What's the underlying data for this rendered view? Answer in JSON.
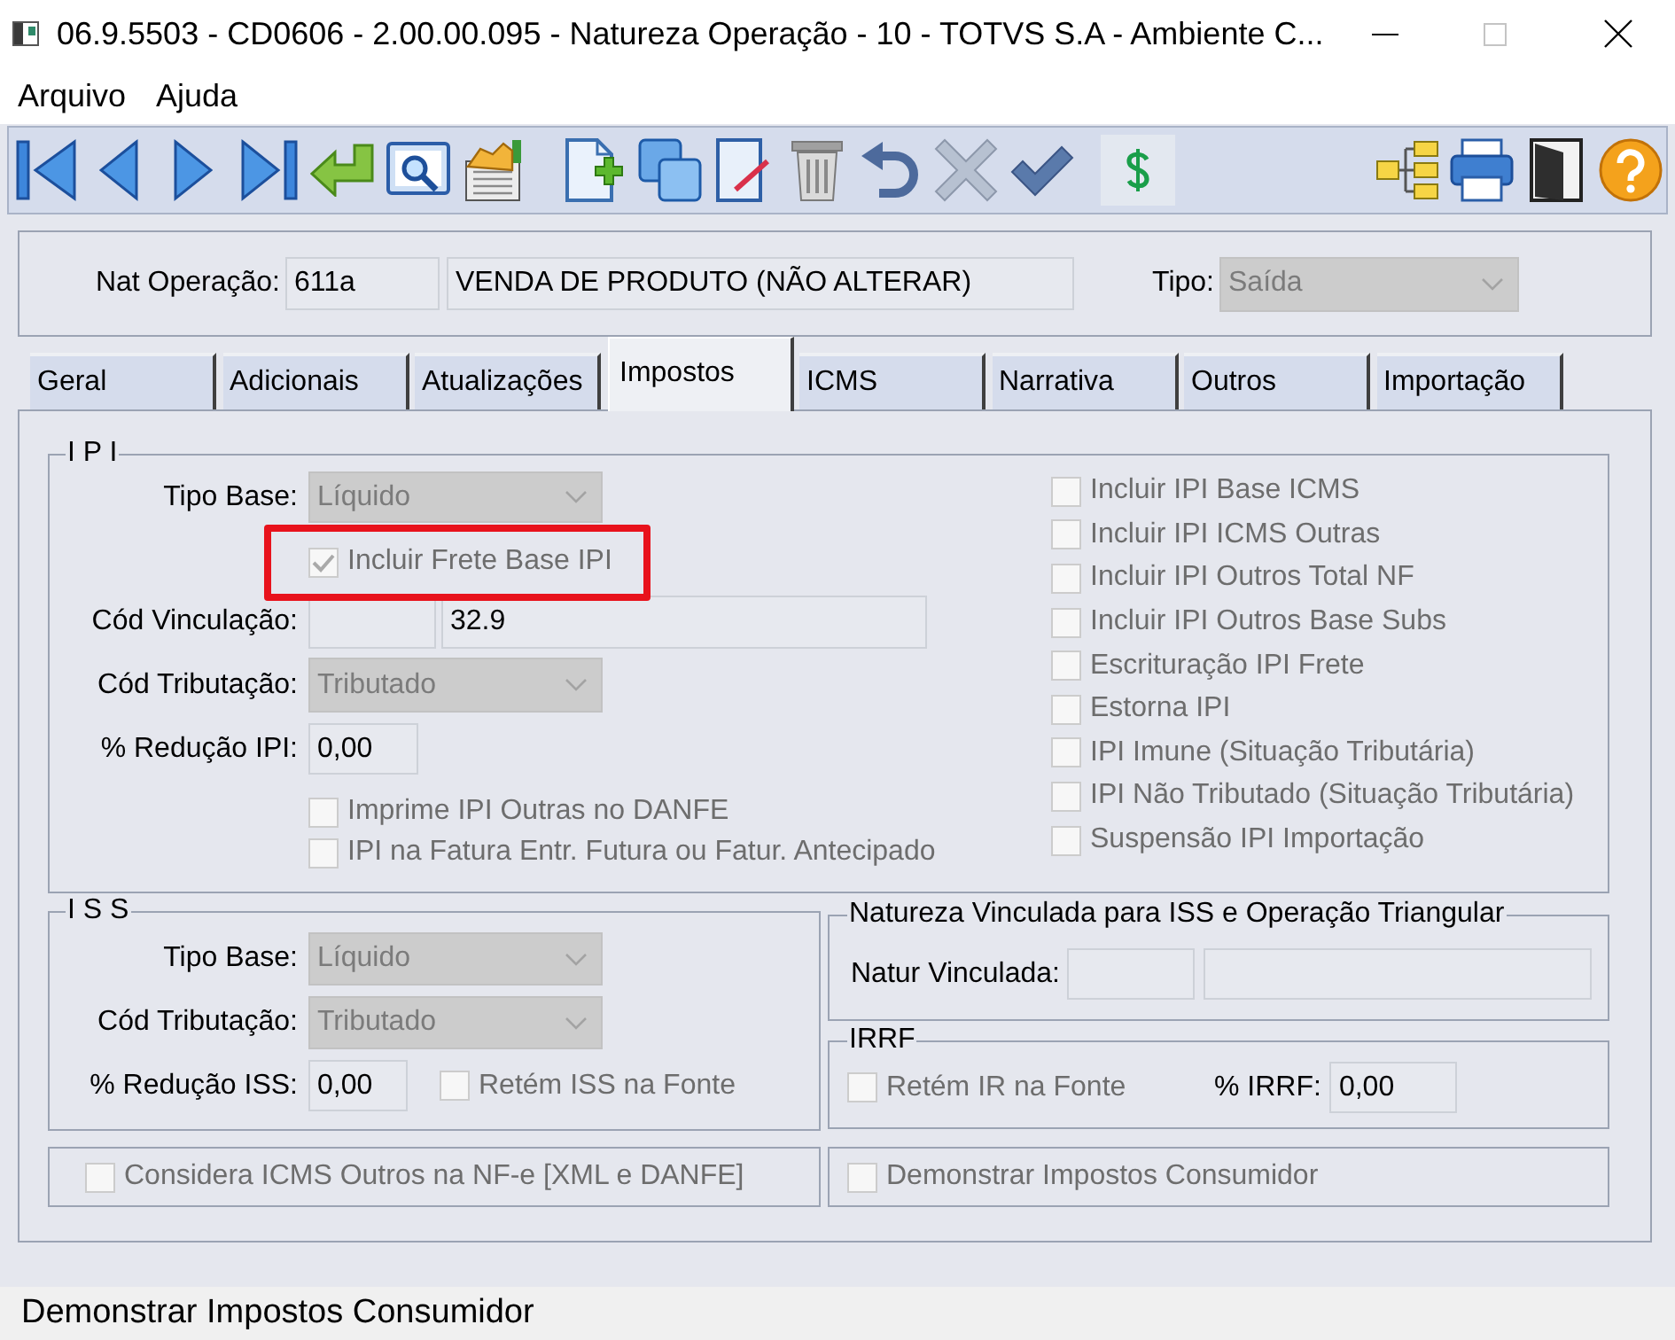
{
  "window": {
    "title": "06.9.5503 - CD0606 - 2.00.00.095 - Natureza Operação - 10 - TOTVS S.A - Ambiente C..."
  },
  "menu": [
    {
      "label": "Arquivo"
    },
    {
      "label": "Ajuda"
    }
  ],
  "header": {
    "nat_operacao": {
      "label": "Nat Operação:",
      "code": "611a",
      "description": "VENDA DE PRODUTO (NÃO ALTERAR)"
    },
    "tipo": {
      "label": "Tipo:",
      "value": "Saída",
      "disabled": true
    }
  },
  "tabs": [
    {
      "label": "Geral",
      "selected": false
    },
    {
      "label": "Adicionais",
      "selected": false
    },
    {
      "label": "Atualizações",
      "selected": false
    },
    {
      "label": "Impostos",
      "selected": true
    },
    {
      "label": "ICMS",
      "selected": false
    },
    {
      "label": "Narrativa",
      "selected": false
    },
    {
      "label": "Outros",
      "selected": false
    },
    {
      "label": "Importação",
      "selected": false
    }
  ],
  "ipi": {
    "legend": "I P I",
    "tipo_base": {
      "label": "Tipo Base:",
      "value": "Líquido",
      "disabled": true
    },
    "incluir_frete": {
      "label": "Incluir Frete Base IPI",
      "checked": true,
      "disabled": true,
      "highlighted": true
    },
    "cod_vinculacao": {
      "label": "Cód Vinculação:",
      "value": "32.9"
    },
    "cod_tributacao": {
      "label": "Cód Tributação:",
      "value": "Tributado",
      "disabled": true
    },
    "reducao": {
      "label": "% Redução IPI:",
      "value": "0,00"
    },
    "options_left": [
      {
        "label": "Imprime IPI Outras no DANFE",
        "checked": false,
        "disabled": true
      },
      {
        "label": "IPI na Fatura Entr. Futura ou Fatur. Antecipado",
        "checked": false,
        "disabled": true
      }
    ],
    "options_right": [
      {
        "label": "Incluir IPI Base ICMS",
        "checked": false,
        "disabled": true
      },
      {
        "label": "Incluir IPI ICMS Outras",
        "checked": false,
        "disabled": true
      },
      {
        "label": "Incluir IPI Outros Total NF",
        "checked": false,
        "disabled": true
      },
      {
        "label": "Incluir IPI Outros Base Subs",
        "checked": false,
        "disabled": true
      },
      {
        "label": "Escrituração IPI Frete",
        "checked": false,
        "disabled": true
      },
      {
        "label": "Estorna IPI",
        "checked": false,
        "disabled": true
      },
      {
        "label": "IPI Imune (Situação Tributária)",
        "checked": false,
        "disabled": true
      },
      {
        "label": "IPI Não Tributado (Situação Tributária)",
        "checked": false,
        "disabled": true
      },
      {
        "label": "Suspensão IPI Importação",
        "checked": false,
        "disabled": true
      }
    ]
  },
  "iss": {
    "legend": "I S S",
    "tipo_base": {
      "label": "Tipo Base:",
      "value": "Líquido",
      "disabled": true
    },
    "cod_tributacao": {
      "label": "Cód Tributação:",
      "value": "Tributado",
      "disabled": true
    },
    "reducao": {
      "label": "% Redução ISS:",
      "value": "0,00"
    },
    "retem": {
      "label": "Retém ISS na Fonte",
      "checked": false,
      "disabled": true
    }
  },
  "natureza_vinculada": {
    "legend": "Natureza Vinculada para ISS e Operação Triangular",
    "label": "Natur Vinculada:"
  },
  "irrf": {
    "legend": "IRRF",
    "retem": {
      "label": "Retém IR na Fonte",
      "checked": false,
      "disabled": true
    },
    "percent": {
      "label": "% IRRF:",
      "value": "0,00"
    }
  },
  "considera_icms": {
    "label": "Considera ICMS Outros na NF-e [XML e DANFE]",
    "checked": false,
    "disabled": true
  },
  "demonstrar_impostos": {
    "label": "Demonstrar Impostos Consumidor",
    "checked": false,
    "disabled": true
  },
  "status_bar": {
    "text": "Demonstrar Impostos Consumidor"
  }
}
